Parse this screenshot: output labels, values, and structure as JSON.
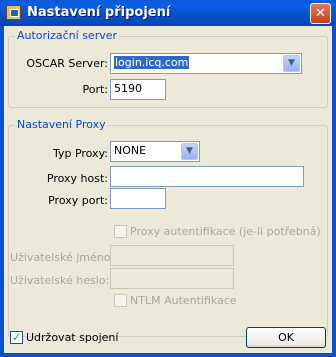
{
  "window": {
    "title": "Nastavení připojení",
    "close_label": "✕"
  },
  "auth_group": {
    "legend": "Autorizační server",
    "server_label": "OSCAR Server:",
    "server_value": "login.icq.com",
    "port_label": "Port:",
    "port_value": "5190"
  },
  "proxy_group": {
    "legend": "Nastavení Proxy",
    "type_label": "Typ Proxy:",
    "type_value": "NONE",
    "host_label": "Proxy host:",
    "host_value": "",
    "port_label": "Proxy port:",
    "port_value": "",
    "auth_checkbox_label": "Proxy autentifikace (je-li potřebná)",
    "username_label": "Uživatelské jméno:",
    "username_value": "",
    "password_label": "Uživatelské heslo:",
    "password_value": "",
    "ntlm_checkbox_label": "NTLM Autentifikace"
  },
  "footer": {
    "keepalive_label": "Udržovat spojení",
    "keepalive_checked": true,
    "ok_label": "OK"
  },
  "icons": {
    "title": "network-settings-icon",
    "dropdown": "chevron-down-icon",
    "check": "checkmark-icon"
  }
}
